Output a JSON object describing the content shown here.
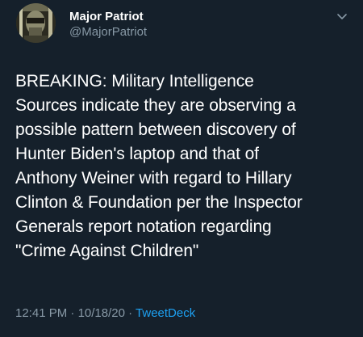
{
  "tweet": {
    "author": {
      "display_name": "Major Patriot",
      "handle": "@MajorPatriot"
    },
    "menu_icon": "chevron-down-icon",
    "text_lines": [
      "BREAKING:  Military Intelligence",
      "Sources indicate they are observing a",
      "possible pattern between discovery of",
      "Hunter Biden's laptop and that of",
      "Anthony Weiner with regard to Hillary",
      "Clinton & Foundation per the Inspector",
      "Generals report notation regarding",
      "\"Crime Against Children\""
    ],
    "time": "12:41 PM",
    "separator": "·",
    "date": "10/18/20",
    "source": "TweetDeck"
  },
  "colors": {
    "background": "#15202b",
    "text": "#ffffff",
    "muted": "#8899a6",
    "link": "#1da1f2"
  }
}
